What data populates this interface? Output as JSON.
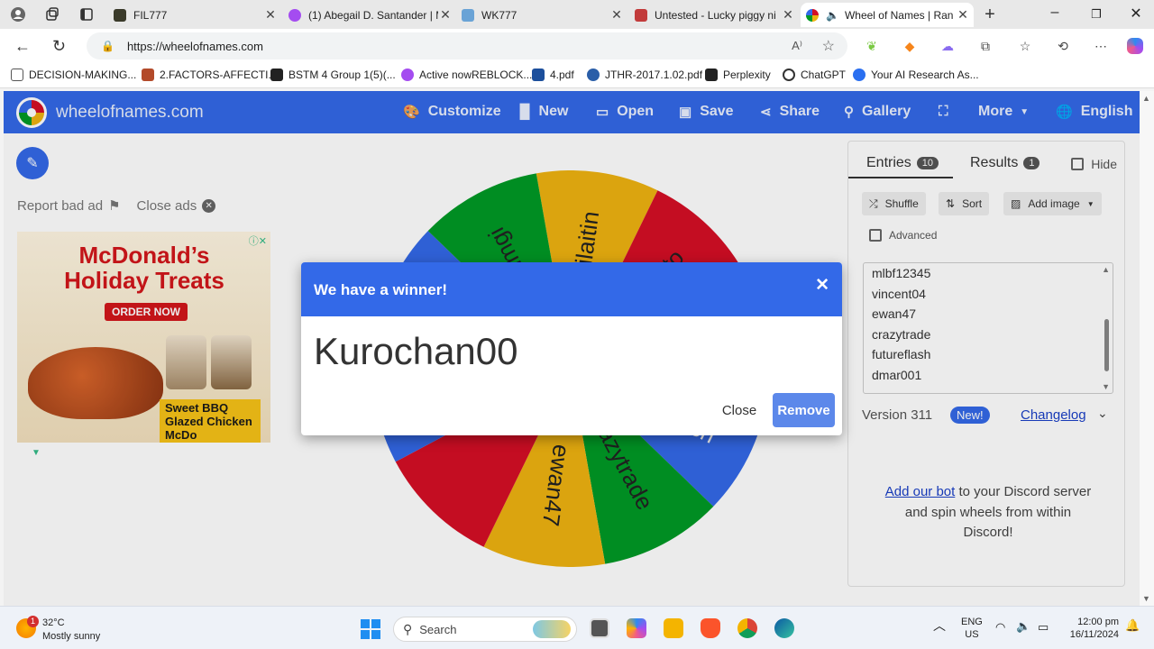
{
  "browser": {
    "tabs": [
      {
        "title": "FIL777",
        "color": "#3a3a2a"
      },
      {
        "title": "(1) Abegail D. Santander | M",
        "color": "#a44cf0"
      },
      {
        "title": "WK777",
        "color": "#6aa3d6"
      },
      {
        "title": "Untested - Lucky piggy ni",
        "color": "#c23b3b"
      },
      {
        "title": "Wheel of Names | Ran",
        "color": "#3369e8"
      }
    ],
    "url": "https://wheelofnames.com",
    "bookmarks": [
      {
        "label": "DECISION-MAKING...",
        "color": "#555"
      },
      {
        "label": "2.FACTORS-AFFECTI...",
        "color": "#b34a2a"
      },
      {
        "label": "BSTM 4 Group 1(5)(...",
        "color": "#222"
      },
      {
        "label": "Active nowREBLOCK...",
        "color": "#a44cf0"
      },
      {
        "label": "4.pdf",
        "color": "#1c4f9c"
      },
      {
        "label": "JTHR-2017.1.02.pdf",
        "color": "#2a5ea8"
      },
      {
        "label": "Perplexity",
        "color": "#222"
      },
      {
        "label": "ChatGPT",
        "color": "#333"
      },
      {
        "label": "Your AI Research As...",
        "color": "#2a6ff0"
      }
    ]
  },
  "appbar": {
    "site": "wheelofnames.com",
    "menu": [
      "Customize",
      "New",
      "Open",
      "Save",
      "Share",
      "Gallery",
      "More",
      "English"
    ]
  },
  "ads": {
    "report": "Report bad ad",
    "close": "Close ads",
    "title": "McDonald’s Holiday Treats",
    "order": "ORDER NOW",
    "promo": "Sweet BBQ Glazed Chicken McDo"
  },
  "wheel": {
    "segments": [
      {
        "label": "Gilaitin",
        "color": "#eeb211"
      },
      {
        "label": "ito",
        "color": "#d50f25"
      },
      {
        "label": "dmar001",
        "color": "#d50f25"
      },
      {
        "label": "futureflash",
        "color": "#3369e8"
      },
      {
        "label": "crazytrade",
        "color": "#009925"
      },
      {
        "label": "ewan47",
        "color": "#eeb211"
      },
      {
        "label": "",
        "color": "#d50f25"
      },
      {
        "label": "",
        "color": "#3369e8"
      },
      {
        "label": "",
        "color": "#3369e8"
      },
      {
        "label": "nmgi",
        "color": "#009925"
      }
    ]
  },
  "panel": {
    "entries_tab": "Entries",
    "entries_count": "10",
    "results_tab": "Results",
    "results_count": "1",
    "hide": "Hide",
    "shuffle": "Shuffle",
    "sort": "Sort",
    "add_image": "Add image",
    "advanced": "Advanced",
    "entries": [
      "mlbf12345",
      "vincent04",
      "ewan47",
      "crazytrade",
      "futureflash",
      "dmar001"
    ],
    "version": "Version 311",
    "new": "New!",
    "changelog": "Changelog",
    "discord_link": "Add our bot",
    "discord_text": " to your Discord server and spin wheels from within Discord!"
  },
  "dialog": {
    "title": "We have a winner!",
    "winner": "Kurochan00",
    "close": "Close",
    "remove": "Remove"
  },
  "taskbar": {
    "notif": "1",
    "temp": "32°C",
    "condition": "Mostly sunny",
    "search": "Search",
    "lang": "ENG",
    "region": "US",
    "time": "12:00 pm",
    "date": "16/11/2024"
  }
}
